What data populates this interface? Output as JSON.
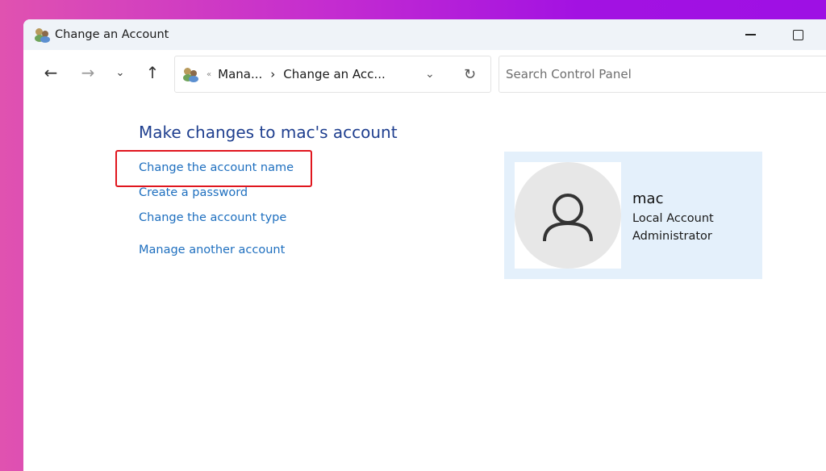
{
  "window": {
    "title": "Change an Account",
    "minimize_icon": "minimize-icon",
    "maximize_icon": "maximize-icon"
  },
  "nav": {
    "back_icon": "arrow-left-icon",
    "forward_icon": "arrow-right-icon",
    "recent_icon": "chevron-down-icon",
    "up_icon": "arrow-up-icon"
  },
  "address": {
    "overflow": "«",
    "crumbs": [
      "Mana...",
      "Change an Acc..."
    ],
    "separator": "›",
    "refresh_icon": "refresh-icon"
  },
  "search": {
    "placeholder": "Search Control Panel"
  },
  "main": {
    "heading": "Make changes to mac's account",
    "links": [
      "Change the account name",
      "Create a password",
      "Change the account type",
      "Manage another account"
    ],
    "highlight_color": "#e0161e"
  },
  "account": {
    "name": "mac",
    "type": "Local Account",
    "role": "Administrator"
  }
}
